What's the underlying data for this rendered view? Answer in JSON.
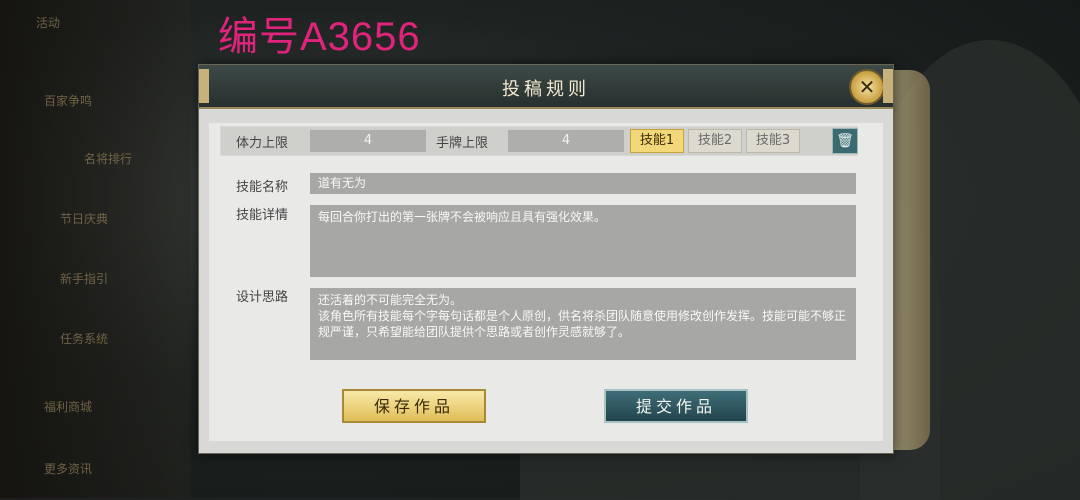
{
  "watermark": "编号A3656",
  "sidebar": {
    "items": [
      "活动",
      "百家争鸣",
      "名将排行",
      "节日庆典",
      "新手指引",
      "任务系统",
      "福利商城",
      "更多资讯"
    ]
  },
  "dialog": {
    "title": "投稿规则",
    "close_icon": "close-icon",
    "stamina_label": "体力上限",
    "stamina_value": "4",
    "hand_label": "手牌上限",
    "hand_value": "4",
    "skill_tabs": [
      "技能1",
      "技能2",
      "技能3"
    ],
    "active_tab": 0,
    "delete_icon": "trash-icon",
    "skill_name_label": "技能名称",
    "skill_name_value": "道有无为",
    "skill_detail_label": "技能详情",
    "skill_detail_value": "每回合你打出的第一张牌不会被响应且具有强化效果。",
    "design_label": "设计思路",
    "design_value": "还活着的不可能完全无为。\n该角色所有技能每个字每句话都是个人原创，供名将杀团队随意使用修改创作发挥。技能可能不够正规严谨，只希望能给团队提供个思路或者创作灵感就够了。",
    "save_button": "保存作品",
    "submit_button": "提交作品"
  },
  "colors": {
    "watermark": "#e0247c",
    "title_bar": "#27302e",
    "gold_button": "#e0be57",
    "teal_button": "#22444c"
  }
}
